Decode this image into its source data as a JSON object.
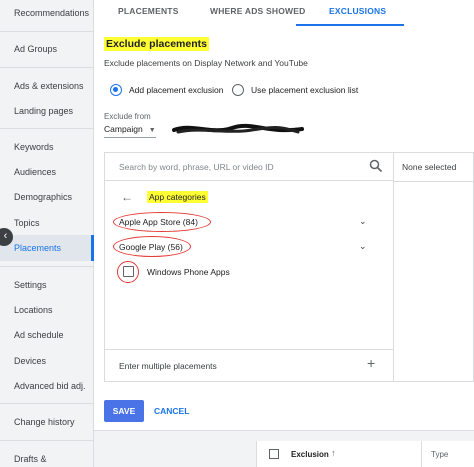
{
  "sidebar": {
    "items": [
      {
        "label": "Recommendations"
      },
      {
        "label": "Ad Groups"
      },
      {
        "label": "Ads & extensions"
      },
      {
        "label": "Landing pages"
      },
      {
        "label": "Keywords"
      },
      {
        "label": "Audiences"
      },
      {
        "label": "Demographics"
      },
      {
        "label": "Topics"
      },
      {
        "label": "Placements",
        "active": true
      },
      {
        "label": "Settings"
      },
      {
        "label": "Locations"
      },
      {
        "label": "Ad schedule"
      },
      {
        "label": "Devices"
      },
      {
        "label": "Advanced bid adj."
      },
      {
        "label": "Change history"
      },
      {
        "label": "Drafts &"
      }
    ],
    "collapse_icon": "chevron-left-icon"
  },
  "tabs": [
    {
      "label": "PLACEMENTS"
    },
    {
      "label": "WHERE ADS SHOWED"
    },
    {
      "label": "EXCLUSIONS",
      "active": true
    }
  ],
  "exclude": {
    "title": "Exclude placements",
    "subtitle": "Exclude placements on Display Network and YouTube",
    "options": [
      {
        "label": "Add placement exclusion",
        "checked": true
      },
      {
        "label": "Use placement exclusion list",
        "checked": false
      }
    ],
    "exclude_from_label": "Exclude from",
    "exclude_from_value": "Campaign"
  },
  "panel": {
    "search_placeholder": "Search by word, phrase, URL or video ID",
    "selected_text": "None selected",
    "category_header": "App categories",
    "categories": [
      {
        "label": "Apple App Store (84)"
      },
      {
        "label": "Google Play (56)"
      }
    ],
    "checkbox_item": "Windows Phone Apps",
    "enter_multiple": "Enter multiple placements"
  },
  "actions": {
    "save": "SAVE",
    "cancel": "CANCEL"
  },
  "table": {
    "col_exclusion": "Exclusion",
    "col_type": "Type"
  },
  "colors": {
    "accent": "#1a73e8",
    "highlight": "#ffff33",
    "annotation": "#e53935"
  }
}
